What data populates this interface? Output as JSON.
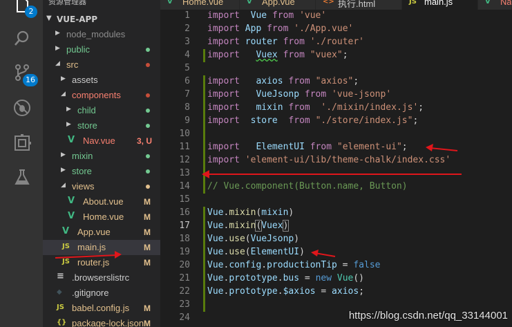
{
  "activity_bar": {
    "explorer_badge": "2",
    "scm_badge": "16"
  },
  "sidebar": {
    "top_label": "资源管理器",
    "project": "VUE-APP",
    "items": [
      {
        "label": "node_modules",
        "type": "folder",
        "expanded": false,
        "depth": 1,
        "color": "#8c8c8c",
        "dot": ""
      },
      {
        "label": "public",
        "type": "folder",
        "expanded": false,
        "depth": 1,
        "color": "#73c991",
        "dot": "#73c991"
      },
      {
        "label": "src",
        "type": "folder",
        "expanded": true,
        "depth": 1,
        "color": "#e2c08d",
        "dot": "#c74e39"
      },
      {
        "label": "assets",
        "type": "folder",
        "expanded": false,
        "depth": 2,
        "color": "#cccccc",
        "dot": ""
      },
      {
        "label": "components",
        "type": "folder",
        "expanded": true,
        "depth": 2,
        "color": "#f88070",
        "dot": "#c74e39"
      },
      {
        "label": "child",
        "type": "folder",
        "expanded": false,
        "depth": 3,
        "color": "#73c991",
        "dot": "#73c991"
      },
      {
        "label": "store",
        "type": "folder",
        "expanded": false,
        "depth": 3,
        "color": "#73c991",
        "dot": "#73c991"
      },
      {
        "label": "Nav.vue",
        "type": "vue",
        "depth": 3,
        "color": "#f88070",
        "status": "3, U",
        "status_color": "#f88070"
      },
      {
        "label": "mixin",
        "type": "folder",
        "expanded": false,
        "depth": 2,
        "color": "#73c991",
        "dot": "#73c991"
      },
      {
        "label": "store",
        "type": "folder",
        "expanded": false,
        "depth": 2,
        "color": "#73c991",
        "dot": "#73c991"
      },
      {
        "label": "views",
        "type": "folder",
        "expanded": true,
        "depth": 2,
        "color": "#e2c08d",
        "dot": "#e2c08d"
      },
      {
        "label": "About.vue",
        "type": "vue",
        "depth": 3,
        "color": "#e2c08d",
        "status": "M",
        "status_color": "#e2c08d"
      },
      {
        "label": "Home.vue",
        "type": "vue",
        "depth": 3,
        "color": "#e2c08d",
        "status": "M",
        "status_color": "#e2c08d"
      },
      {
        "label": "App.vue",
        "type": "vue",
        "depth": 2,
        "color": "#e2c08d",
        "status": "M",
        "status_color": "#e2c08d"
      },
      {
        "label": "main.js",
        "type": "js",
        "depth": 2,
        "color": "#e2c08d",
        "status": "M",
        "status_color": "#e2c08d",
        "selected": true
      },
      {
        "label": "router.js",
        "type": "js",
        "depth": 2,
        "color": "#e2c08d",
        "status": "M",
        "status_color": "#e2c08d"
      },
      {
        "label": ".browserslistrc",
        "type": "list",
        "depth": 1,
        "color": "#cccccc",
        "status": ""
      },
      {
        "label": ".gitignore",
        "type": "git",
        "depth": 1,
        "color": "#cccccc",
        "status": ""
      },
      {
        "label": "babel.config.js",
        "type": "js",
        "depth": 1,
        "color": "#e2c08d",
        "status": "M",
        "status_color": "#e2c08d"
      },
      {
        "label": "package-lock.json",
        "type": "json",
        "depth": 1,
        "color": "#e2c08d",
        "status": "M",
        "status_color": "#e2c08d"
      }
    ]
  },
  "tabs": [
    {
      "label": "Home.vue",
      "icon": "V",
      "icon_color": "#41b883",
      "color": "#e2c08d",
      "active": false
    },
    {
      "label": "App.vue",
      "icon": "V",
      "icon_color": "#41b883",
      "color": "#e2c08d",
      "active": false
    },
    {
      "label": "执行.html",
      "icon": "<>",
      "icon_color": "#e37933",
      "color": "#cccccc",
      "active": false
    },
    {
      "label": "main.js",
      "icon": "JS",
      "icon_color": "#cbcb41",
      "color": "#ffffff",
      "active": true
    },
    {
      "label": "Nav.vu",
      "icon": "V",
      "icon_color": "#41b883",
      "color": "#f88070",
      "active": false
    }
  ],
  "editor": {
    "current_line": 17,
    "lines": [
      {
        "n": 1,
        "tokens": [
          [
            "kw",
            "import"
          ],
          [
            "",
            "  "
          ],
          [
            "var",
            "Vue"
          ],
          [
            "",
            " "
          ],
          [
            "kw",
            "from"
          ],
          [
            "",
            " "
          ],
          [
            "str",
            "'vue'"
          ]
        ]
      },
      {
        "n": 2,
        "tokens": [
          [
            "kw",
            "import"
          ],
          [
            "",
            " "
          ],
          [
            "var",
            "App"
          ],
          [
            "",
            " "
          ],
          [
            "kw",
            "from"
          ],
          [
            "",
            " "
          ],
          [
            "str",
            "'./App.vue'"
          ]
        ]
      },
      {
        "n": 3,
        "tokens": [
          [
            "kw",
            "import"
          ],
          [
            "",
            " "
          ],
          [
            "var",
            "router"
          ],
          [
            "",
            " "
          ],
          [
            "kw",
            "from"
          ],
          [
            "",
            " "
          ],
          [
            "str",
            "'./router'"
          ]
        ]
      },
      {
        "n": 4,
        "tokens": [
          [
            "kw",
            "import"
          ],
          [
            "",
            "   "
          ],
          [
            "var wavy",
            "Vuex"
          ],
          [
            "",
            " "
          ],
          [
            "kw",
            "from"
          ],
          [
            "",
            " "
          ],
          [
            "str",
            "\"vuex\""
          ],
          [
            "",
            ";"
          ]
        ]
      },
      {
        "n": 5,
        "tokens": []
      },
      {
        "n": 6,
        "tokens": [
          [
            "kw",
            "import"
          ],
          [
            "",
            "   "
          ],
          [
            "var",
            "axios"
          ],
          [
            "",
            " "
          ],
          [
            "kw",
            "from"
          ],
          [
            "",
            " "
          ],
          [
            "str",
            "\"axios\""
          ],
          [
            "",
            ";"
          ]
        ]
      },
      {
        "n": 7,
        "tokens": [
          [
            "kw",
            "import"
          ],
          [
            "",
            "   "
          ],
          [
            "var",
            "VueJsonp"
          ],
          [
            "",
            " "
          ],
          [
            "kw",
            "from"
          ],
          [
            "",
            " "
          ],
          [
            "str",
            "'vue-jsonp'"
          ]
        ]
      },
      {
        "n": 8,
        "tokens": [
          [
            "kw",
            "import"
          ],
          [
            "",
            "   "
          ],
          [
            "var",
            "mixin"
          ],
          [
            "",
            " "
          ],
          [
            "kw",
            "from"
          ],
          [
            "",
            "  "
          ],
          [
            "str",
            "'./mixin/index.js'"
          ],
          [
            "",
            ";"
          ]
        ]
      },
      {
        "n": 9,
        "tokens": [
          [
            "kw",
            "import"
          ],
          [
            "",
            "  "
          ],
          [
            "var",
            "store"
          ],
          [
            "",
            "  "
          ],
          [
            "kw",
            "from"
          ],
          [
            "",
            " "
          ],
          [
            "str",
            "\"./store/index.js\""
          ],
          [
            "",
            ";"
          ]
        ]
      },
      {
        "n": 10,
        "tokens": []
      },
      {
        "n": 11,
        "tokens": [
          [
            "kw",
            "import"
          ],
          [
            "",
            "   "
          ],
          [
            "var",
            "ElementUI"
          ],
          [
            "",
            " "
          ],
          [
            "kw",
            "from"
          ],
          [
            "",
            " "
          ],
          [
            "str",
            "\"element-ui\""
          ],
          [
            "",
            ";"
          ]
        ]
      },
      {
        "n": 12,
        "tokens": [
          [
            "kw",
            "import"
          ],
          [
            "",
            " "
          ],
          [
            "str",
            "'element-ui/lib/theme-chalk/index.css'"
          ]
        ]
      },
      {
        "n": 13,
        "tokens": []
      },
      {
        "n": 14,
        "tokens": [
          [
            "cmt",
            "// Vue.component(Button.name, Button)"
          ]
        ]
      },
      {
        "n": 15,
        "tokens": []
      },
      {
        "n": 16,
        "tokens": [
          [
            "var",
            "Vue"
          ],
          [
            "",
            "."
          ],
          [
            "fn",
            "mixin"
          ],
          [
            "",
            "("
          ],
          [
            "var",
            "mixin"
          ],
          [
            "",
            ")"
          ]
        ]
      },
      {
        "n": 17,
        "tokens": [
          [
            "var",
            "Vue"
          ],
          [
            "",
            "."
          ],
          [
            "fn",
            "mixin"
          ],
          [
            "bracket",
            "("
          ],
          [
            "var",
            "Vuex"
          ],
          [
            "bracket",
            ")"
          ]
        ]
      },
      {
        "n": 18,
        "tokens": [
          [
            "var",
            "Vue"
          ],
          [
            "",
            "."
          ],
          [
            "fn",
            "use"
          ],
          [
            "",
            "("
          ],
          [
            "var",
            "VueJsonp"
          ],
          [
            "",
            ")"
          ]
        ]
      },
      {
        "n": 19,
        "tokens": [
          [
            "var",
            "Vue"
          ],
          [
            "",
            "."
          ],
          [
            "fn",
            "use"
          ],
          [
            "",
            "("
          ],
          [
            "var",
            "ElementUI"
          ],
          [
            "",
            ")"
          ]
        ]
      },
      {
        "n": 20,
        "tokens": [
          [
            "var",
            "Vue"
          ],
          [
            "",
            "."
          ],
          [
            "var",
            "config"
          ],
          [
            "",
            "."
          ],
          [
            "var",
            "productionTip"
          ],
          [
            "",
            " = "
          ],
          [
            "bool",
            "false"
          ]
        ]
      },
      {
        "n": 21,
        "tokens": [
          [
            "var",
            "Vue"
          ],
          [
            "",
            "."
          ],
          [
            "var",
            "prototype"
          ],
          [
            "",
            "."
          ],
          [
            "var",
            "bus"
          ],
          [
            "",
            " = "
          ],
          [
            "bool",
            "new"
          ],
          [
            "",
            " "
          ],
          [
            "cls",
            "Vue"
          ],
          [
            "",
            "()"
          ]
        ]
      },
      {
        "n": 22,
        "tokens": [
          [
            "var",
            "Vue"
          ],
          [
            "",
            "."
          ],
          [
            "var",
            "prototype"
          ],
          [
            "",
            "."
          ],
          [
            "var",
            "$axios"
          ],
          [
            "",
            " = "
          ],
          [
            "var",
            "axios"
          ],
          [
            "",
            ";"
          ]
        ]
      },
      {
        "n": 23,
        "tokens": []
      },
      {
        "n": 24,
        "tokens": []
      }
    ]
  },
  "watermark": "https://blog.csdn.net/qq_33144001"
}
